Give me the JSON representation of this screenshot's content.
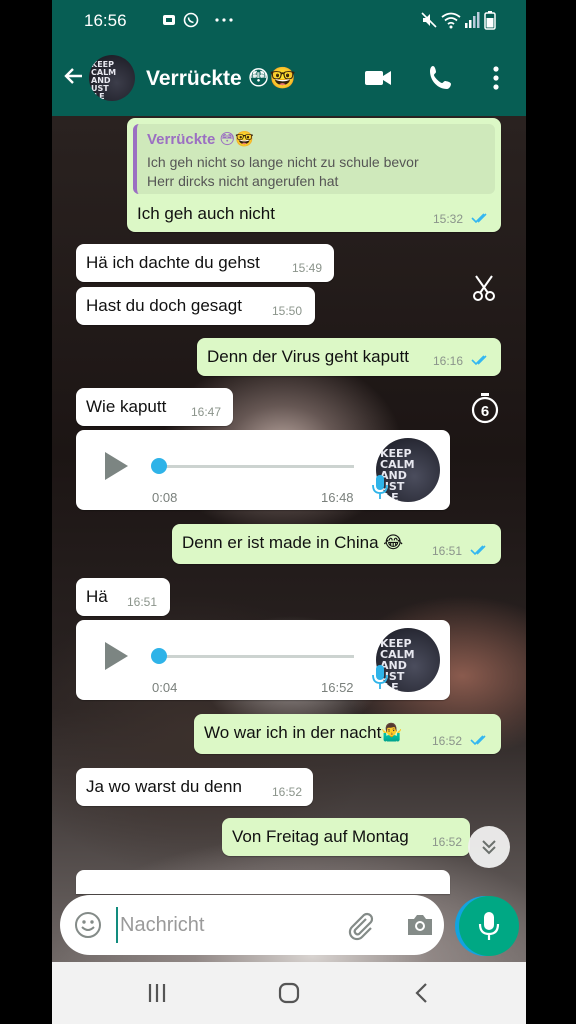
{
  "status_bar": {
    "time": "16:56"
  },
  "header": {
    "avatar_text": [
      "KEEP",
      "CALM",
      "AND",
      "UST",
      "ILE"
    ],
    "title": "Verrückte 😳🤓"
  },
  "messages": [
    {
      "dir": "out",
      "quote_author": "Verrückte 😳🤓",
      "quote_line1": "Ich geh nicht so lange nicht zu schule bevor",
      "quote_line2": "Herr dircks nicht angerufen hat",
      "text": "Ich geh auch  nicht",
      "time": "15:32"
    },
    {
      "dir": "in",
      "text": "Hä ich dachte du gehst",
      "time": "15:49"
    },
    {
      "dir": "in",
      "text": "Hast du doch gesagt",
      "time": "15:50"
    },
    {
      "dir": "out",
      "text": "Denn der Virus geht kaputt",
      "time": "16:16"
    },
    {
      "dir": "in",
      "text": "Wie kaputt",
      "time": "16:47"
    },
    {
      "dir": "in",
      "type": "voice",
      "duration": "0:08",
      "time": "16:48"
    },
    {
      "dir": "out",
      "text": "Denn er ist made in China 😂",
      "time": "16:51"
    },
    {
      "dir": "in",
      "text": "Hä",
      "time": "16:51"
    },
    {
      "dir": "in",
      "type": "voice",
      "duration": "0:04",
      "time": "16:52"
    },
    {
      "dir": "out",
      "text": "Wo war ich in der nacht🤷‍♂️",
      "time": "16:52"
    },
    {
      "dir": "in",
      "text": "Ja wo warst du denn",
      "time": "16:52"
    },
    {
      "dir": "out",
      "text": "Von Freitag auf Montag",
      "time": "16:52"
    }
  ],
  "composer": {
    "placeholder": "Nachricht"
  },
  "colors": {
    "header": "#075e54",
    "outgoing_bubble": "#dcf8c6",
    "incoming_bubble": "#ffffff",
    "accent": "#00a884",
    "read_ticks": "#34b7f1"
  }
}
